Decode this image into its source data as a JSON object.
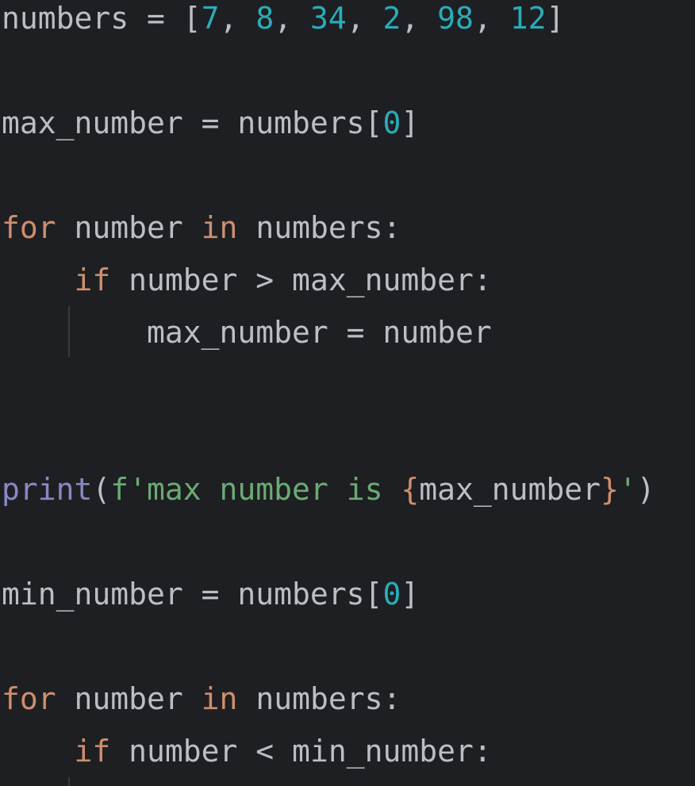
{
  "editor": {
    "theme": {
      "background": "#1e1f22",
      "text": "#bcbec4",
      "keyword": "#cf8e6d",
      "number": "#2aacb8",
      "string": "#6aab73",
      "builtin": "#8888c6",
      "indent_guide": "#393b40"
    },
    "lines": [
      {
        "tokens": [
          {
            "t": "numbers = [",
            "c": "plain"
          },
          {
            "t": "7",
            "c": "num"
          },
          {
            "t": ", ",
            "c": "plain"
          },
          {
            "t": "8",
            "c": "num"
          },
          {
            "t": ", ",
            "c": "plain"
          },
          {
            "t": "34",
            "c": "num"
          },
          {
            "t": ", ",
            "c": "plain"
          },
          {
            "t": "2",
            "c": "num"
          },
          {
            "t": ", ",
            "c": "plain"
          },
          {
            "t": "98",
            "c": "num"
          },
          {
            "t": ", ",
            "c": "plain"
          },
          {
            "t": "12",
            "c": "num"
          },
          {
            "t": "]",
            "c": "plain"
          }
        ]
      },
      {
        "tokens": []
      },
      {
        "tokens": [
          {
            "t": "max_number = numbers[",
            "c": "plain"
          },
          {
            "t": "0",
            "c": "num"
          },
          {
            "t": "]",
            "c": "plain"
          }
        ]
      },
      {
        "tokens": []
      },
      {
        "tokens": [
          {
            "t": "for",
            "c": "kw"
          },
          {
            "t": " number ",
            "c": "plain"
          },
          {
            "t": "in",
            "c": "kw"
          },
          {
            "t": " numbers:",
            "c": "plain"
          }
        ]
      },
      {
        "tokens": [
          {
            "t": "    ",
            "c": "plain"
          },
          {
            "t": "if",
            "c": "kw"
          },
          {
            "t": " number > max_number:",
            "c": "plain"
          }
        ]
      },
      {
        "tokens": [
          {
            "t": "        max_number = number",
            "c": "plain"
          }
        ]
      },
      {
        "tokens": []
      },
      {
        "tokens": []
      },
      {
        "tokens": [
          {
            "t": "print",
            "c": "builtin"
          },
          {
            "t": "(",
            "c": "plain"
          },
          {
            "t": "f'max number is ",
            "c": "str"
          },
          {
            "t": "{",
            "c": "brace"
          },
          {
            "t": "max_number",
            "c": "plain"
          },
          {
            "t": "}",
            "c": "brace"
          },
          {
            "t": "'",
            "c": "str"
          },
          {
            "t": ")",
            "c": "plain"
          }
        ]
      },
      {
        "tokens": []
      },
      {
        "tokens": [
          {
            "t": "min_number = numbers[",
            "c": "plain"
          },
          {
            "t": "0",
            "c": "num"
          },
          {
            "t": "]",
            "c": "plain"
          }
        ]
      },
      {
        "tokens": []
      },
      {
        "tokens": [
          {
            "t": "for",
            "c": "kw"
          },
          {
            "t": " number ",
            "c": "plain"
          },
          {
            "t": "in",
            "c": "kw"
          },
          {
            "t": " numbers:",
            "c": "plain"
          }
        ]
      },
      {
        "tokens": [
          {
            "t": "    ",
            "c": "plain"
          },
          {
            "t": "if",
            "c": "kw"
          },
          {
            "t": " number < min_number:",
            "c": "plain"
          }
        ]
      }
    ]
  }
}
